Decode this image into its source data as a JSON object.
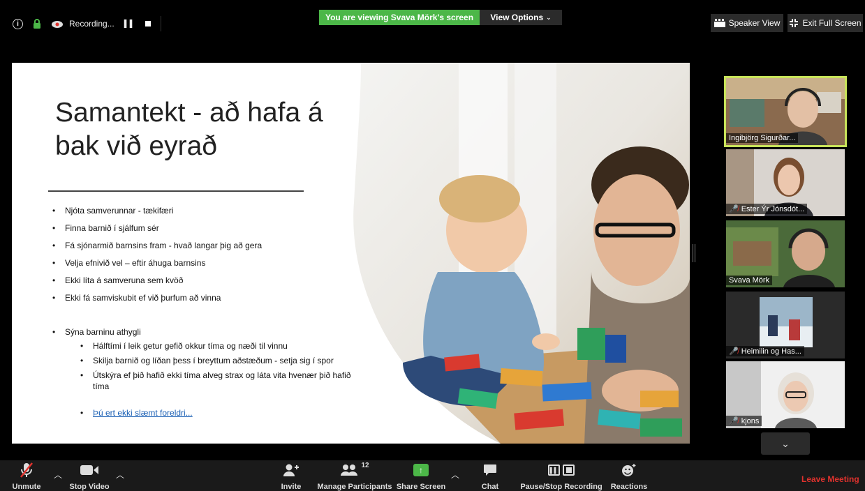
{
  "topbar": {
    "recording_label": "Recording...",
    "viewing_text": "You are viewing Svava Mörk's screen",
    "view_options_label": "View Options",
    "speaker_view_label": "Speaker View",
    "exit_fullscreen_label": "Exit Full Screen"
  },
  "slide": {
    "title": "Samantekt - að hafa á bak við eyrað",
    "bullets": [
      "Njóta samverunnar - tækifæri",
      "Finna barnið í sjálfum sér",
      "Fá sjónarmið barnsins fram - hvað langar þig að gera",
      "Velja efnivið vel – eftir áhuga barnsins",
      "Ekki líta á samveruna sem kvöð",
      "Ekki fá samviskubit ef við þurfum að vinna"
    ],
    "bullet_main2": "Sýna barninu athygli",
    "sub_bullets": [
      "Hálftími í leik getur gefið okkur tíma og næði til vinnu",
      "Skilja barnið og líðan þess í breyttum aðstæðum - setja sig í spor",
      "Útskýra ef þið hafið ekki tíma alveg strax og láta vita hvenær þið hafið tíma"
    ],
    "link_text": "Þú ert ekki slæmt foreldri..."
  },
  "participants": [
    {
      "name": "Ingibjörg Sigurðar...",
      "muted": false,
      "active": true
    },
    {
      "name": "Ester Ýr Jónsdót...",
      "muted": true,
      "active": false
    },
    {
      "name": "Svava Mörk",
      "muted": false,
      "active": false
    },
    {
      "name": "Heimilin og Has...",
      "muted": true,
      "active": false
    },
    {
      "name": "kjons",
      "muted": true,
      "active": false
    }
  ],
  "toolbar": {
    "unmute": "Unmute",
    "stop_video": "Stop Video",
    "invite": "Invite",
    "participants_count": "12",
    "manage_participants": "Manage Participants",
    "share_screen": "Share Screen",
    "chat": "Chat",
    "pause_stop_recording": "Pause/Stop Recording",
    "reactions": "Reactions",
    "leave": "Leave Meeting"
  },
  "colors": {
    "accent_green": "#4cb748",
    "leave_red": "#e0322d",
    "active_speaker": "#c8e35a"
  }
}
